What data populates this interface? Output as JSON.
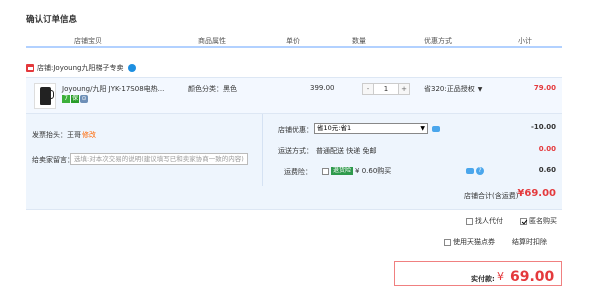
{
  "page_title": "确认订单信息",
  "table_headers": [
    "店铺宝贝",
    "商品属性",
    "单价",
    "数量",
    "优惠方式",
    "小计"
  ],
  "shop": {
    "prefix": "店铺:",
    "name": "Joyoung九阳梯子专卖"
  },
  "item": {
    "name": "Joyoung/九阳 JYK-17S08电热...",
    "attribute": "颜色分类：黑色",
    "price": "399.00",
    "quantity": "1",
    "minus": "-",
    "plus": "+",
    "promotion": "省320:正品授权",
    "subtotal": "79.00"
  },
  "invoice": {
    "label": "发票抬头：王哥",
    "link": "修改"
  },
  "message": {
    "label": "给卖家留言：",
    "placeholder": "选填:对本次交易的说明(建议填写已和卖家协商一致的内容)"
  },
  "shop_promo": {
    "label": "店铺优惠：",
    "selected": "省10元:省1",
    "value": "-10.00"
  },
  "shipping": {
    "label": "运送方式：",
    "method": "普通配送 快递 免邮",
    "value": "0.00"
  },
  "insurance": {
    "label": "运费险：",
    "tag": "退货险",
    "price": "¥ 0.60购买",
    "value": "0.60"
  },
  "shop_total": {
    "label": "店铺合计(含运费)",
    "value": "¥69.00"
  },
  "checkboxes": {
    "pay_for_me": "找人代付",
    "anonymous": "匿名购买",
    "tmall_points": "使用天猫点券",
    "settle": "结算时扣除"
  },
  "payment": {
    "label": "实付款:",
    "currency": "¥",
    "amount": "69.00"
  },
  "colors": {
    "accent_red": "#e4393c",
    "header_border": "#b2d1ff",
    "row_bg": "#f3f8ff"
  }
}
